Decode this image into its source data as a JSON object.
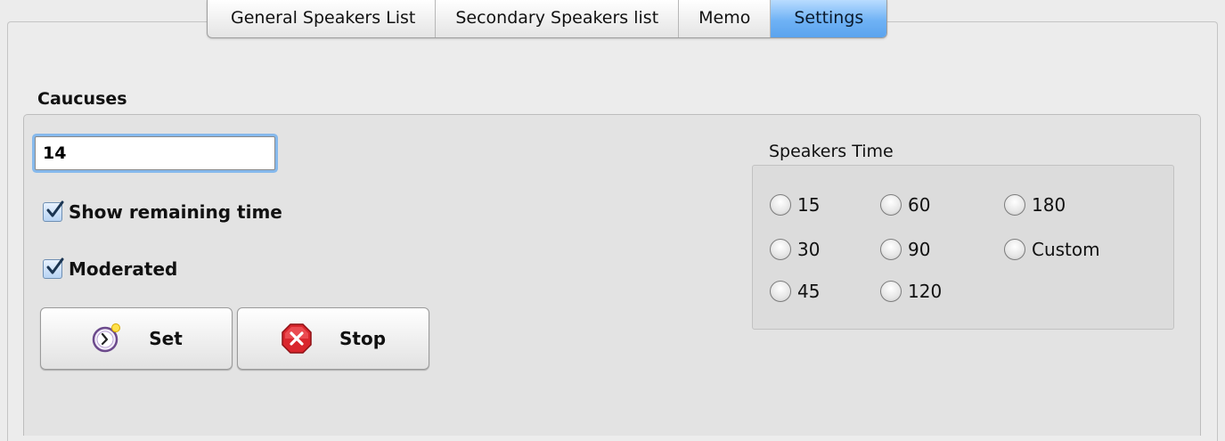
{
  "tabs": [
    {
      "label": "General Speakers List",
      "selected": false
    },
    {
      "label": "Secondary Speakers list",
      "selected": false
    },
    {
      "label": "Memo",
      "selected": false
    },
    {
      "label": "Settings",
      "selected": true
    }
  ],
  "caucuses": {
    "title": "Caucuses",
    "duration_value": "14",
    "show_remaining_time": {
      "label": "Show remaining time",
      "checked": true
    },
    "moderated": {
      "label": "Moderated",
      "checked": true
    },
    "set_button": {
      "label": "Set",
      "icon": "timer-icon"
    },
    "stop_button": {
      "label": "Stop",
      "icon": "stop-icon"
    }
  },
  "speakers_time": {
    "title": "Speakers Time",
    "options": [
      "15",
      "60",
      "180",
      "30",
      "90",
      "Custom",
      "45",
      "120"
    ]
  },
  "colors": {
    "selected_tab": "#6fb2f5",
    "focus_ring": "#86b9ec",
    "stop_red": "#d9262d"
  }
}
